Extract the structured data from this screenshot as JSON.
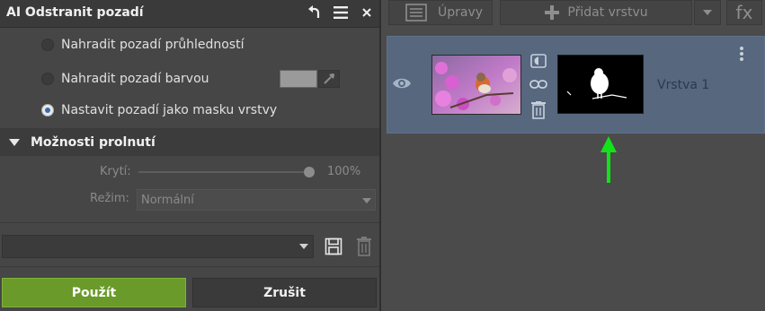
{
  "left_panel": {
    "title": "AI Odstranit pozadí",
    "options": [
      {
        "label": "Nahradit pozadí průhledností",
        "checked": false
      },
      {
        "label": "Nahradit pozadí barvou",
        "checked": false
      },
      {
        "label": "Nastavit pozadí jako masku vrstvy",
        "checked": true
      }
    ],
    "background_color": "#9a9a9a",
    "blend_section": {
      "title": "Možnosti prolnutí",
      "opacity_label": "Krytí:",
      "opacity_value": "100%",
      "opacity_fraction": 1.0,
      "mode_label": "Režim:",
      "mode_value": "Normální"
    },
    "preset_value": "",
    "apply_label": "Použít",
    "cancel_label": "Zrušit",
    "accent_color": "#6a9a2a"
  },
  "right_panel": {
    "edits_label": "Úpravy",
    "add_layer_label": "Přidat vrstvu",
    "fx_label": "fx",
    "layer": {
      "name": "Vrstva 1",
      "visible": true,
      "selected_color": "#56677e"
    },
    "arrow_color": "#12e21a"
  }
}
